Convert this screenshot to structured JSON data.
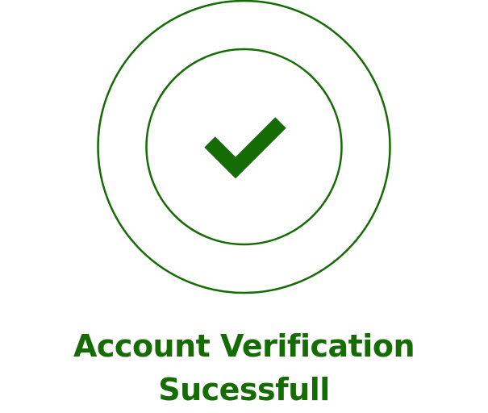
{
  "status": {
    "line1": "Account Verification",
    "line2": "Sucessfull"
  },
  "icons": {
    "outer_ring": "outer-ring-icon",
    "inner_ring": "inner-ring-icon",
    "checkmark": "checkmark-icon"
  },
  "colors": {
    "accent": "#156c05",
    "background": "#ffffff"
  }
}
